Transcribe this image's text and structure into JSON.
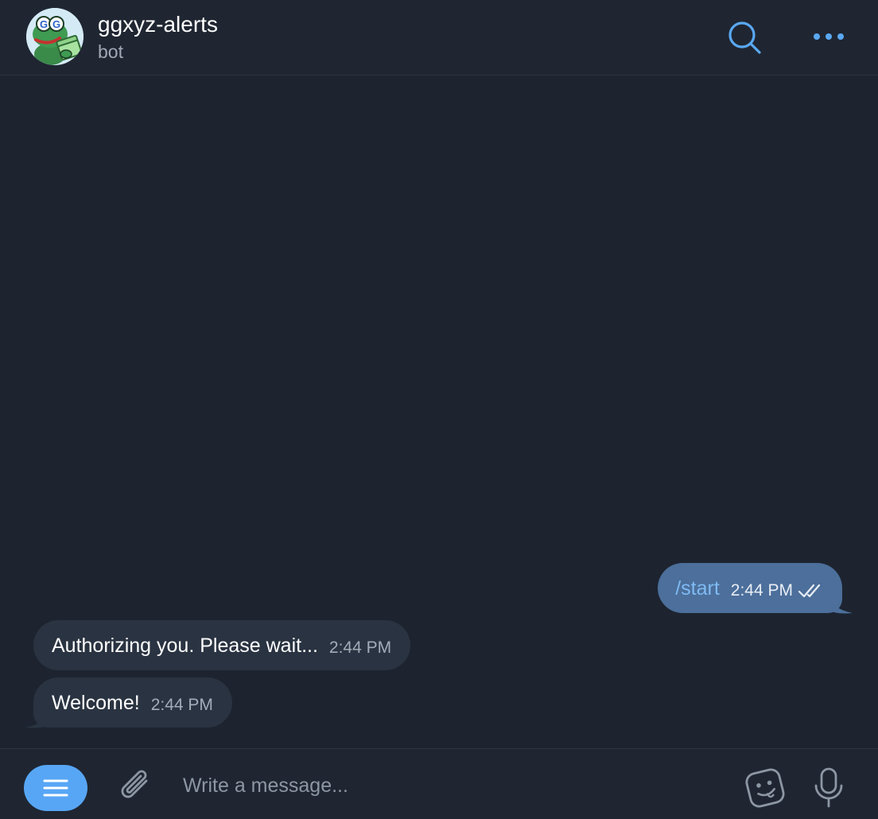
{
  "header": {
    "title": "ggxyz-alerts",
    "subtitle": "bot",
    "avatar_icon": "frog-holding-money-icon",
    "search_icon": "search-icon",
    "more_icon": "more-horizontal-icon"
  },
  "messages": [
    {
      "direction": "outgoing",
      "text": "/start",
      "time": "2:44 PM",
      "status": "read"
    },
    {
      "direction": "incoming",
      "text": "Authorizing you. Please wait...",
      "time": "2:44 PM"
    },
    {
      "direction": "incoming",
      "text": "Welcome!",
      "time": "2:44 PM"
    }
  ],
  "composer": {
    "placeholder": "Write a message...",
    "menu_icon": "menu-icon",
    "attach_icon": "paperclip-icon",
    "sticker_icon": "sticker-icon",
    "mic_icon": "microphone-icon"
  },
  "colors": {
    "background": "#1d2430",
    "outgoing_bubble": "#4c6f9b",
    "incoming_bubble": "#2a3341",
    "accent": "#57a6f5",
    "command_link": "#7fbaf3"
  }
}
